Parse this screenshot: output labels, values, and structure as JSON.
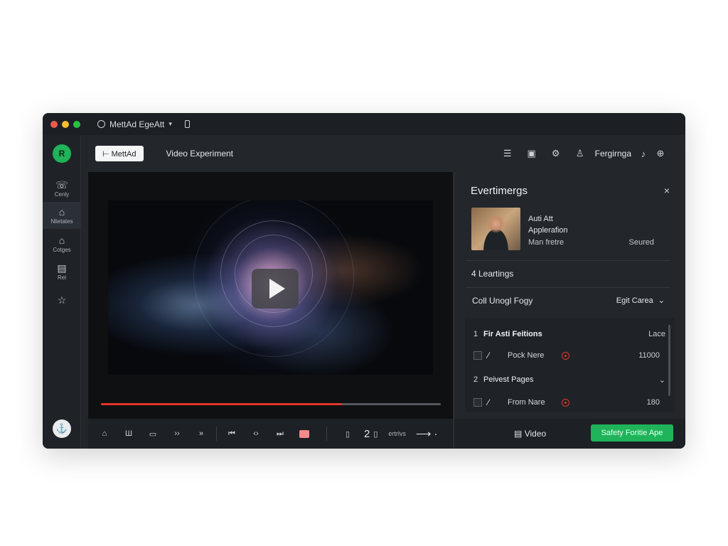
{
  "titlebar": {
    "dot_colors": [
      "#ee5a52",
      "#f5bd2f",
      "#27c23f"
    ],
    "app_title": "MettAd EgeAtt",
    "chevron": "▾"
  },
  "sidebar": {
    "logo_text": "R",
    "items": [
      {
        "icon": "phone-icon",
        "glyph": "☏",
        "label": "Cenly"
      },
      {
        "icon": "briefcase-icon",
        "glyph": "⌂",
        "label": "Nlietates"
      },
      {
        "icon": "home-icon",
        "glyph": "⌂",
        "label": "Cotges"
      },
      {
        "icon": "document-icon",
        "glyph": "▤",
        "label": "Rel"
      },
      {
        "icon": "star-icon",
        "glyph": "☆",
        "label": ""
      }
    ],
    "avatar_glyph": "⚓",
    "bottom_icon_glyph": "⊡"
  },
  "header": {
    "brand_button": "⊢ MettAd",
    "video_title": "Video Experiment",
    "user_name": "Fergirnga",
    "icons": [
      "list-icon",
      "bookmark-icon",
      "settings-icon",
      "user-icon",
      "bell-icon",
      "globe-icon"
    ]
  },
  "video": {
    "progress": 0.71,
    "progress_color": "#e2352a"
  },
  "controls": {
    "count": "2",
    "label": "ertrlvs",
    "arrow": "⟶ ·",
    "stop_color": "#f28b8b"
  },
  "panel": {
    "title": "Evertimergs",
    "close": "×",
    "profile": {
      "line1": "Auti Att",
      "line2": "Applerafion",
      "sub": "Man fretre",
      "status": "Seured"
    },
    "learnings": "4 Leartings",
    "filter_label": "Coll Unogl Fogy",
    "filter_value": "Egit Carea",
    "list": [
      {
        "num": "1",
        "title": "Fir Asti Feitions",
        "right": "Lace"
      },
      {
        "name": "Pock Nere",
        "value": "11000"
      },
      {
        "num": "2",
        "title": "Peivest Pages",
        "right": "⌄"
      },
      {
        "name": "From Nare",
        "value": "180"
      }
    ]
  },
  "footer": {
    "video_label": "Video",
    "cta": "Safety Foritie Ape",
    "cta_color": "#1fb45a"
  }
}
